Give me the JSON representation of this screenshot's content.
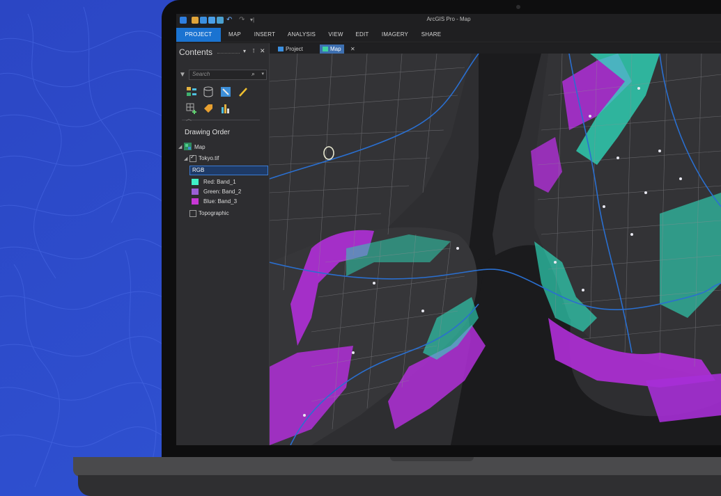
{
  "window": {
    "title": "ArcGIS Pro  -  Map"
  },
  "ribbon": {
    "tabs": [
      "PROJECT",
      "MAP",
      "INSERT",
      "ANALYSIS",
      "VIEW",
      "EDIT",
      "IMAGERY",
      "SHARE"
    ],
    "active": "PROJECT"
  },
  "contents": {
    "title": "Contents",
    "search_placeholder": "Search",
    "drawing_order_label": "Drawing Order",
    "map_label": "Map",
    "layer_label": "Tokyo.tif",
    "renderer_label": "RGB",
    "bands": [
      {
        "label": "Red:  Band_1",
        "color": "#3ff0c8"
      },
      {
        "label": "Green: Band_2",
        "color": "#9b5fd6"
      },
      {
        "label": "Blue:  Band_3",
        "color": "#c837d6"
      }
    ],
    "basemap_label": "Topographic"
  },
  "map_tabs": [
    {
      "label": "Project",
      "icon": "project-icon"
    },
    {
      "label": "Map",
      "icon": "map-icon",
      "active": true
    }
  ],
  "colors": {
    "accent": "#1a73d1",
    "flood_teal": "#2fe0c0",
    "flood_purple": "#b02fd8",
    "background": "#2a4fc8"
  }
}
